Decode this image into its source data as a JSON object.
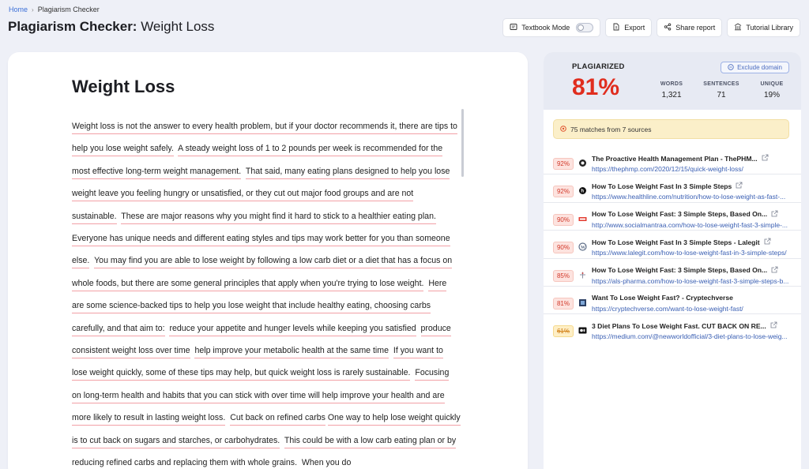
{
  "breadcrumb": {
    "home": "Home",
    "current": "Plagiarism Checker"
  },
  "header": {
    "title_bold": "Plagiarism Checker:",
    "title_rest": " Weight Loss"
  },
  "toolbar": {
    "textbook_mode": "Textbook Mode",
    "textbook_mode_on": false,
    "export": "Export",
    "share": "Share report",
    "tutorial": "Tutorial Library"
  },
  "document": {
    "title": "Weight Loss",
    "segments": [
      "Weight loss is not the answer to every health problem, but if your doctor recommends it, there are tips to help you lose weight safely.",
      "A steady weight loss of 1 to 2 pounds per week is recommended for the most effective long-term weight management.",
      "That said, many eating plans designed to help you lose weight leave you feeling hungry or unsatisfied, or they cut out major food groups and are not sustainable.",
      "These are major reasons why you might find it hard to stick to a healthier eating plan.",
      "Everyone has unique needs and different eating styles and tips may work better for you than someone else.",
      "You may find you are able to lose weight by following a low carb diet or a diet that has a focus on whole foods, but there are some general principles that apply when you're trying to lose weight.",
      "Here are some science-backed tips to help you lose weight that include healthy eating, choosing carbs carefully, and that aim to:",
      "reduce your appetite and hunger levels while keeping you satisfied",
      "produce consistent weight loss over time",
      "help improve your metabolic health at the same time",
      "If you want to lose weight quickly, some of these tips may help, but quick weight loss is rarely sustainable.",
      "Focusing on long-term health and habits that you can stick with over time will help improve your health and are more likely to result in lasting weight loss.",
      "Cut back on refined carbs",
      "One way to help lose weight quickly is to cut back on sugars and starches, or carbohydrates.",
      "This could be with a low carb eating plan or by reducing refined carbs and replacing them with whole grains.",
      "When you do"
    ]
  },
  "report": {
    "label": "PLAGIARIZED",
    "percent": "81%",
    "exclude_domain": "Exclude domain",
    "stats": [
      {
        "label": "WORDS",
        "value": "1,321"
      },
      {
        "label": "SENTENCES",
        "value": "71"
      },
      {
        "label": "UNIQUE",
        "value": "19%"
      }
    ],
    "matches_summary": "75 matches from 7 sources",
    "colors": {
      "plagiarized": "#e02d1e",
      "accent": "#3b6fd8",
      "warn": "#d07d12"
    },
    "sources": [
      {
        "pct": "92%",
        "title": "The Proactive Health Management Plan - ThePHM...",
        "url": "https://thephmp.com/2020/12/15/quick-weight-loss/",
        "icon": "thephmp-favicon",
        "warn": false
      },
      {
        "pct": "92%",
        "title": "How To Lose Weight Fast In 3 Simple Steps",
        "url": "https://www.healthline.com/nutrition/how-to-lose-weight-as-fast-...",
        "icon": "healthline-favicon",
        "warn": false
      },
      {
        "pct": "90%",
        "title": "How To Lose Weight Fast: 3 Simple Steps, Based On...",
        "url": "http://www.socialmantraa.com/how-to-lose-weight-fast-3-simple-...",
        "icon": "socialmantraa-favicon",
        "warn": false
      },
      {
        "pct": "90%",
        "title": "How To Lose Weight Fast In 3 Simple Steps - Lalegit",
        "url": "https://www.lalegit.com/how-to-lose-weight-fast-in-3-simple-steps/",
        "icon": "wordpress-favicon",
        "warn": false
      },
      {
        "pct": "85%",
        "title": "How To Lose Weight Fast: 3 Simple Steps, Based On...",
        "url": "https://als-pharma.com/how-to-lose-weight-fast-3-simple-steps-b...",
        "icon": "als-pharma-favicon",
        "warn": false
      },
      {
        "pct": "81%",
        "title": "Want To Lose Weight Fast? - Cryptechverse",
        "url": "https://cryptechverse.com/want-to-lose-weight-fast/",
        "icon": "cryptechverse-favicon",
        "warn": false
      },
      {
        "pct": "61%",
        "title": "3 Diet Plans To Lose Weight Fast. CUT BACK ON RE...",
        "url": "https://medium.com/@newworldofficial/3-diet-plans-to-lose-weig...",
        "icon": "medium-favicon",
        "warn": true
      }
    ]
  }
}
